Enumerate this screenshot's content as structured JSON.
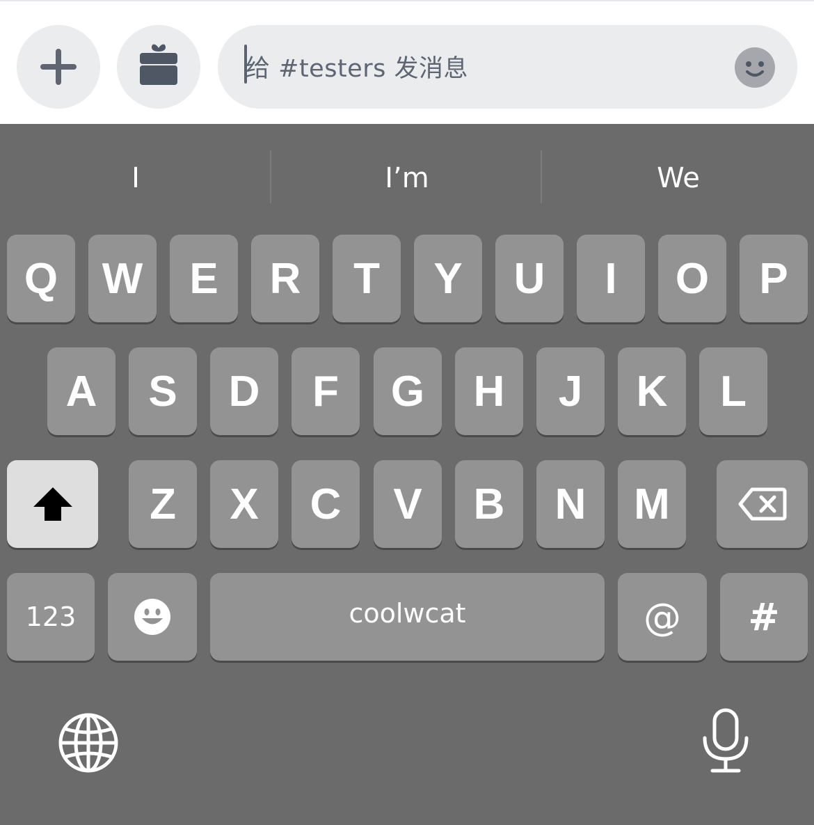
{
  "composer": {
    "placeholder": "给 #testers 发消息",
    "plus_icon": "plus-icon",
    "gift_icon": "gift-icon",
    "emoji_icon": "smile-icon"
  },
  "keyboard": {
    "suggestions": [
      "I",
      "I’m",
      "We"
    ],
    "row1": [
      "Q",
      "W",
      "E",
      "R",
      "T",
      "Y",
      "U",
      "I",
      "O",
      "P"
    ],
    "row2": [
      "A",
      "S",
      "D",
      "F",
      "G",
      "H",
      "J",
      "K",
      "L"
    ],
    "row3": [
      "Z",
      "X",
      "C",
      "V",
      "B",
      "N",
      "M"
    ],
    "numbers_label": "123",
    "space_label": "coolwcat",
    "at_label": "@",
    "hash_label": "#",
    "shift_icon": "shift-arrow-icon",
    "delete_icon": "backspace-icon",
    "emoji_icon": "emoji-icon",
    "globe_icon": "globe-icon",
    "mic_icon": "microphone-icon"
  },
  "colors": {
    "keyboard_bg": "#6b6b6b",
    "key_bg": "#939393",
    "shift_bg": "#dedede",
    "field_bg": "#ebecee"
  }
}
